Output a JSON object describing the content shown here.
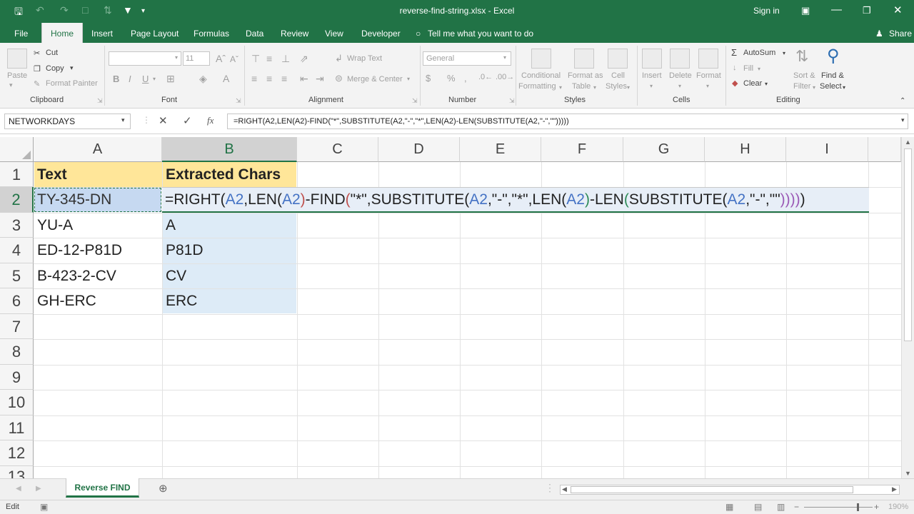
{
  "app": {
    "file_title": "reverse-find-string.xlsx  -  Excel",
    "sign_in": "Sign in",
    "share": "Share"
  },
  "tabs": [
    "File",
    "Home",
    "Insert",
    "Page Layout",
    "Formulas",
    "Data",
    "Review",
    "View",
    "Developer"
  ],
  "tell_me": "Tell me what you want to do",
  "ribbon": {
    "clipboard": {
      "paste": "Paste",
      "cut": "Cut",
      "copy": "Copy",
      "format_painter": "Format Painter",
      "group": "Clipboard"
    },
    "font": {
      "size": "11",
      "bold": "B",
      "italic": "I",
      "underline": "U",
      "group": "Font"
    },
    "alignment": {
      "wrap_text": "Wrap Text",
      "merge_center": "Merge & Center",
      "group": "Alignment"
    },
    "number": {
      "format": "General",
      "group": "Number"
    },
    "styles": {
      "conditional": "Conditional",
      "formatting": "Formatting",
      "format_as": "Format as",
      "table": "Table",
      "cell": "Cell",
      "cell_styles": "Styles",
      "group": "Styles"
    },
    "cells": {
      "insert": "Insert",
      "delete": "Delete",
      "format": "Format",
      "group": "Cells"
    },
    "editing": {
      "autosum": "AutoSum",
      "fill": "Fill",
      "clear": "Clear",
      "sort": "Sort &",
      "filter": "Filter",
      "find": "Find &",
      "select": "Select",
      "group": "Editing"
    }
  },
  "formula_bar": {
    "name_box": "NETWORKDAYS",
    "formula": "=RIGHT(A2,LEN(A2)-FIND(\"*\",SUBSTITUTE(A2,\"-\",\"*\",LEN(A2)-LEN(SUBSTITUTE(A2,\"-\",\"\")))))",
    "fx": "fx"
  },
  "columns": [
    "A",
    "B",
    "C",
    "D",
    "E",
    "F",
    "G",
    "H",
    "I"
  ],
  "rows": [
    "1",
    "2",
    "3",
    "4",
    "5",
    "6",
    "7",
    "8",
    "9",
    "10",
    "11",
    "12",
    "13"
  ],
  "cells": {
    "A1": "Text",
    "B1": "Extracted Chars",
    "A2": "TY-345-DN",
    "A3": "YU-A",
    "B3": "A",
    "A4": "ED-12-P81D",
    "B4": "P81D",
    "A5": "B-423-2-CV",
    "B5": "CV",
    "A6": "GH-ERC",
    "B6": "ERC"
  },
  "edit_formula_parts": [
    {
      "t": "=RIGHT(",
      "c": "#222222"
    },
    {
      "t": "A2",
      "c": "#4472c4"
    },
    {
      "t": ",LEN(",
      "c": "#222222"
    },
    {
      "t": "A2",
      "c": "#4472c4"
    },
    {
      "t": ")",
      "c": "#c0504d"
    },
    {
      "t": "-FIND",
      "c": "#222222"
    },
    {
      "t": "(",
      "c": "#c0504d"
    },
    {
      "t": "\"*\",SUBSTITUTE(",
      "c": "#222222"
    },
    {
      "t": "A2",
      "c": "#4472c4"
    },
    {
      "t": ",\"-\",\"*\",LEN(",
      "c": "#222222"
    },
    {
      "t": "A2",
      "c": "#4472c4"
    },
    {
      "t": ")",
      "c": "#2e8b57"
    },
    {
      "t": "-LEN",
      "c": "#222222"
    },
    {
      "t": "(",
      "c": "#2e8b57"
    },
    {
      "t": "SUBSTITUTE(",
      "c": "#222222"
    },
    {
      "t": "A2",
      "c": "#4472c4"
    },
    {
      "t": ",\"-\",\"\"",
      "c": "#222222"
    },
    {
      "t": "))))",
      "c": "#9b59b6"
    },
    {
      "t": ")",
      "c": "#222222"
    }
  ],
  "sheet_tab": "Reverse FIND",
  "status": {
    "mode": "Edit",
    "zoom": "190%"
  },
  "colors": {
    "excel_green": "#217346",
    "header_fill": "#ffe699",
    "selection_fill": "#ddebf7"
  }
}
